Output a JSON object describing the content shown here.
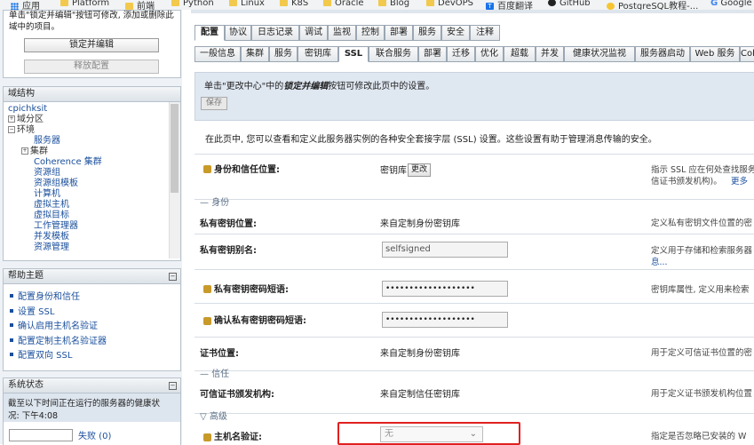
{
  "bookmarks": [
    {
      "label": "应用",
      "icon": "apps-icon"
    },
    {
      "label": "Platform",
      "icon": "folder-icon"
    },
    {
      "label": "前端",
      "icon": "folder-icon"
    },
    {
      "label": "Python",
      "icon": "folder-icon"
    },
    {
      "label": "Linux",
      "icon": "folder-icon"
    },
    {
      "label": "K8S",
      "icon": "folder-icon"
    },
    {
      "label": "Oracle",
      "icon": "folder-icon"
    },
    {
      "label": "Blog",
      "icon": "folder-icon"
    },
    {
      "label": "DevOPS",
      "icon": "folder-icon"
    },
    {
      "label": "百度翻译",
      "icon": "translate-icon"
    },
    {
      "label": "GitHub",
      "icon": "github-icon"
    },
    {
      "label": "PostgreSQL教程-...",
      "icon": "postgres-icon"
    },
    {
      "label": "Google",
      "icon": "google-icon"
    }
  ],
  "change_center": {
    "desc_line1": "单击\"锁定并编辑\"按钮可修改, 添加或删除此",
    "desc_line2": "域中的项目。",
    "lock_button": "锁定并编辑",
    "release_button": "释放配置"
  },
  "domain_structure": {
    "title": "域结构",
    "root": "cpichksit",
    "items": [
      "域分区",
      "环境",
      "服务器",
      "集群",
      "Coherence 集群",
      "资源组",
      "资源组模板",
      "计算机",
      "虚拟主机",
      "虚拟目标",
      "工作管理器",
      "并发模板",
      "资源管理"
    ]
  },
  "help": {
    "title": "帮助主题",
    "links": [
      "配置身份和信任",
      "设置 SSL",
      "确认启用主机名验证",
      "配置定制主机名验证器",
      "配置双向 SSL"
    ]
  },
  "system_status": {
    "title": "系统状态",
    "line1": "截至以下时间正在运行的服务器的健康状",
    "line2": "况: 下午4:08",
    "failed_label": "失败 (0)"
  },
  "main": {
    "top_tabs": [
      "配置",
      "协议",
      "日志记录",
      "调试",
      "监视",
      "控制",
      "部署",
      "服务",
      "安全",
      "注释"
    ],
    "sub_tabs": [
      "一般信息",
      "集群",
      "服务",
      "密钥库",
      "SSL",
      "联合服务",
      "部署",
      "迁移",
      "优化",
      "超载",
      "并发",
      "健康状况监视",
      "服务器启动",
      "Web 服务",
      "Cohe"
    ],
    "info_text_prefix": "单击\"更改中心\"中的",
    "info_text_em": "锁定并编辑",
    "info_text_suffix": "按钮可修改此页中的设置。",
    "save_button": "保存",
    "intro": "在此页中, 您可以查看和定义此服务器实例的各种安全套接字层 (SSL) 设置。这些设置有助于管理消息传输的安全。",
    "identity_trust_label": "身份和信任位置:",
    "identity_trust_value": "密钥库",
    "change_button": "更改",
    "identity_trust_desc1": "指示 SSL 应在何处查找服务",
    "identity_trust_desc2": "信证书颁发机构)。",
    "more_link": "更多",
    "section_identity": "身份",
    "private_key_location_label": "私有密钥位置:",
    "private_key_location_value": "来自定制身份密钥库",
    "private_key_location_desc": "定义私有密钥文件位置的密",
    "private_key_alias_label": "私有密钥别名:",
    "private_key_alias_value": "selfsigned",
    "private_key_alias_desc1": "定义用于存储和检索服务器",
    "private_key_alias_desc2": "息...",
    "pass_label": "私有密钥密码短语:",
    "pass_value": "•••••••••••••••••••",
    "pass_desc": "密钥库属性, 定义用来检索",
    "confirm_label": "确认私有密钥密码短语:",
    "confirm_value": "•••••••••••••••••••",
    "cert_location_label": "证书位置:",
    "cert_location_value": "来自定制身份密钥库",
    "cert_location_desc": "用于定义可信证书位置的密",
    "section_trust": "信任",
    "trusted_ca_label": "可信证书颁发机构:",
    "trusted_ca_value": "来自定制信任密钥库",
    "trusted_ca_desc": "用于定义证书颁发机构位置",
    "section_advanced": "高级",
    "hostname_label": "主机名验证:",
    "hostname_value": "无",
    "hostname_desc": "指定是否忽略已安装的 W"
  }
}
